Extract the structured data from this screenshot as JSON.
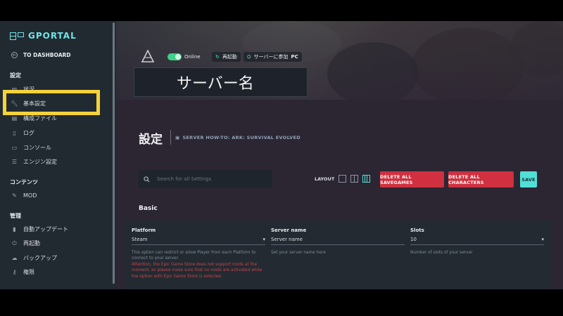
{
  "sidebar": {
    "brand": "GPORTAL",
    "dashboard": "TO DASHBOARD",
    "sections": {
      "settings": "設定",
      "contents": "コンテンツ",
      "admin": "管理"
    },
    "items": [
      {
        "label": "状況",
        "icon": "chart-icon"
      },
      {
        "label": "基本設定",
        "icon": "wrench-icon"
      },
      {
        "label": "構成ファイル",
        "icon": "file-icon"
      },
      {
        "label": "ログ",
        "icon": "log-icon"
      },
      {
        "label": "コンソール",
        "icon": "console-icon"
      },
      {
        "label": "エンジン設定",
        "icon": "sliders-icon"
      },
      {
        "label": "MOD",
        "icon": "mod-icon"
      },
      {
        "label": "自動アップデート",
        "icon": "update-icon"
      },
      {
        "label": "再起動",
        "icon": "power-icon"
      },
      {
        "label": "バックアップ",
        "icon": "cloud-icon"
      },
      {
        "label": "権限",
        "icon": "key-icon"
      }
    ]
  },
  "header": {
    "status": "Online",
    "restart": "再起動",
    "join": "サーバーに参加",
    "platform": "PC",
    "server_name": "サーバー名"
  },
  "page": {
    "title": "設定",
    "howto": "SERVER HOW-TO: ARK: SURVIVAL EVOLVED",
    "search_placeholder": "Search for all Settings",
    "layout_label": "LAYOUT",
    "delete_savegames": "DELETE ALL SAVEGAMES",
    "delete_characters": "DELETE ALL CHARACTERS",
    "save": "SAVE",
    "section_basic": "Basic"
  },
  "fields": {
    "platform": {
      "label": "Platform",
      "value": "Steam",
      "help": "This option can restrict or allow Player from each Platform to connect to your server.",
      "warning": "Attention, the Epic Game Store does not support mods at the moment, so please make sure that no mods are activated while the option with Epic Game Store is selected."
    },
    "server_name": {
      "label": "Server name",
      "value": "Server name",
      "help": "Set your server name here"
    },
    "slots": {
      "label": "Slots",
      "value": "10",
      "help": "Number of slots of your server"
    }
  },
  "colors": {
    "accent": "#52e0d6",
    "danger": "#d0303f",
    "highlight": "#f5d33a",
    "online": "#3fd08a"
  }
}
